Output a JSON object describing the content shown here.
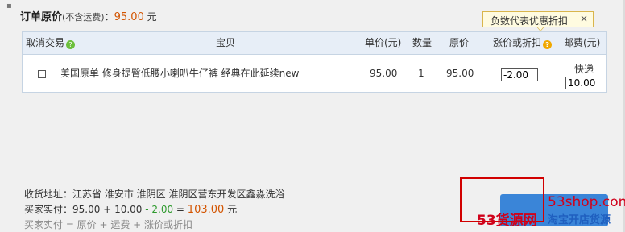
{
  "header": {
    "title": "订单原价",
    "note": "(不含运费)",
    "colon": "：",
    "price": "95.00",
    "unit": "元"
  },
  "tooltip": {
    "text": "负数代表优惠折扣",
    "close": "×"
  },
  "table": {
    "columns": [
      "取消交易",
      "宝贝",
      "单价(元)",
      "数量",
      "原价",
      "涨价或折扣",
      "邮费(元)"
    ],
    "row": {
      "item": "美国原单 修身提臀低腰小喇叭牛仔裤 经典在此延续new",
      "unit_price": "95.00",
      "qty": "1",
      "original": "95.00",
      "adjust": "-2.00",
      "shipping_method": "快递",
      "shipping_fee": "10.00"
    }
  },
  "summary": {
    "address_label": "收货地址：",
    "address": "江苏省 淮安市 淮阴区 淮阴区营东开发区鑫淼洗浴",
    "pay_label": "买家实付：",
    "pay_a": "95.00",
    "plus": " + ",
    "pay_b": "10.00",
    "minus": " - ",
    "pay_c": "2.00",
    "eq": " = ",
    "total": "103.00",
    "unit": " 元",
    "formula": "买家实付 = 原价 + 运费 + 涨价或折扣"
  },
  "watermark": {
    "domain": "53shop.com",
    "site": "53货源网",
    "slogan": "淘宝开店货源"
  }
}
